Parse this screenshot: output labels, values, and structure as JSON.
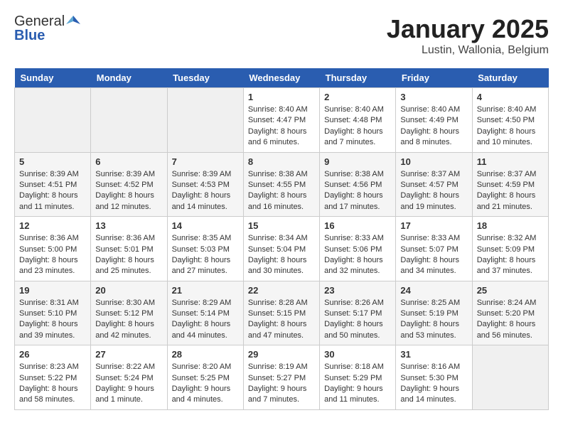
{
  "logo": {
    "general": "General",
    "blue": "Blue"
  },
  "title": "January 2025",
  "location": "Lustin, Wallonia, Belgium",
  "days_of_week": [
    "Sunday",
    "Monday",
    "Tuesday",
    "Wednesday",
    "Thursday",
    "Friday",
    "Saturday"
  ],
  "weeks": [
    [
      {
        "day": "",
        "content": ""
      },
      {
        "day": "",
        "content": ""
      },
      {
        "day": "",
        "content": ""
      },
      {
        "day": "1",
        "content": "Sunrise: 8:40 AM\nSunset: 4:47 PM\nDaylight: 8 hours\nand 6 minutes."
      },
      {
        "day": "2",
        "content": "Sunrise: 8:40 AM\nSunset: 4:48 PM\nDaylight: 8 hours\nand 7 minutes."
      },
      {
        "day": "3",
        "content": "Sunrise: 8:40 AM\nSunset: 4:49 PM\nDaylight: 8 hours\nand 8 minutes."
      },
      {
        "day": "4",
        "content": "Sunrise: 8:40 AM\nSunset: 4:50 PM\nDaylight: 8 hours\nand 10 minutes."
      }
    ],
    [
      {
        "day": "5",
        "content": "Sunrise: 8:39 AM\nSunset: 4:51 PM\nDaylight: 8 hours\nand 11 minutes."
      },
      {
        "day": "6",
        "content": "Sunrise: 8:39 AM\nSunset: 4:52 PM\nDaylight: 8 hours\nand 12 minutes."
      },
      {
        "day": "7",
        "content": "Sunrise: 8:39 AM\nSunset: 4:53 PM\nDaylight: 8 hours\nand 14 minutes."
      },
      {
        "day": "8",
        "content": "Sunrise: 8:38 AM\nSunset: 4:55 PM\nDaylight: 8 hours\nand 16 minutes."
      },
      {
        "day": "9",
        "content": "Sunrise: 8:38 AM\nSunset: 4:56 PM\nDaylight: 8 hours\nand 17 minutes."
      },
      {
        "day": "10",
        "content": "Sunrise: 8:37 AM\nSunset: 4:57 PM\nDaylight: 8 hours\nand 19 minutes."
      },
      {
        "day": "11",
        "content": "Sunrise: 8:37 AM\nSunset: 4:59 PM\nDaylight: 8 hours\nand 21 minutes."
      }
    ],
    [
      {
        "day": "12",
        "content": "Sunrise: 8:36 AM\nSunset: 5:00 PM\nDaylight: 8 hours\nand 23 minutes."
      },
      {
        "day": "13",
        "content": "Sunrise: 8:36 AM\nSunset: 5:01 PM\nDaylight: 8 hours\nand 25 minutes."
      },
      {
        "day": "14",
        "content": "Sunrise: 8:35 AM\nSunset: 5:03 PM\nDaylight: 8 hours\nand 27 minutes."
      },
      {
        "day": "15",
        "content": "Sunrise: 8:34 AM\nSunset: 5:04 PM\nDaylight: 8 hours\nand 30 minutes."
      },
      {
        "day": "16",
        "content": "Sunrise: 8:33 AM\nSunset: 5:06 PM\nDaylight: 8 hours\nand 32 minutes."
      },
      {
        "day": "17",
        "content": "Sunrise: 8:33 AM\nSunset: 5:07 PM\nDaylight: 8 hours\nand 34 minutes."
      },
      {
        "day": "18",
        "content": "Sunrise: 8:32 AM\nSunset: 5:09 PM\nDaylight: 8 hours\nand 37 minutes."
      }
    ],
    [
      {
        "day": "19",
        "content": "Sunrise: 8:31 AM\nSunset: 5:10 PM\nDaylight: 8 hours\nand 39 minutes."
      },
      {
        "day": "20",
        "content": "Sunrise: 8:30 AM\nSunset: 5:12 PM\nDaylight: 8 hours\nand 42 minutes."
      },
      {
        "day": "21",
        "content": "Sunrise: 8:29 AM\nSunset: 5:14 PM\nDaylight: 8 hours\nand 44 minutes."
      },
      {
        "day": "22",
        "content": "Sunrise: 8:28 AM\nSunset: 5:15 PM\nDaylight: 8 hours\nand 47 minutes."
      },
      {
        "day": "23",
        "content": "Sunrise: 8:26 AM\nSunset: 5:17 PM\nDaylight: 8 hours\nand 50 minutes."
      },
      {
        "day": "24",
        "content": "Sunrise: 8:25 AM\nSunset: 5:19 PM\nDaylight: 8 hours\nand 53 minutes."
      },
      {
        "day": "25",
        "content": "Sunrise: 8:24 AM\nSunset: 5:20 PM\nDaylight: 8 hours\nand 56 minutes."
      }
    ],
    [
      {
        "day": "26",
        "content": "Sunrise: 8:23 AM\nSunset: 5:22 PM\nDaylight: 8 hours\nand 58 minutes."
      },
      {
        "day": "27",
        "content": "Sunrise: 8:22 AM\nSunset: 5:24 PM\nDaylight: 9 hours\nand 1 minute."
      },
      {
        "day": "28",
        "content": "Sunrise: 8:20 AM\nSunset: 5:25 PM\nDaylight: 9 hours\nand 4 minutes."
      },
      {
        "day": "29",
        "content": "Sunrise: 8:19 AM\nSunset: 5:27 PM\nDaylight: 9 hours\nand 7 minutes."
      },
      {
        "day": "30",
        "content": "Sunrise: 8:18 AM\nSunset: 5:29 PM\nDaylight: 9 hours\nand 11 minutes."
      },
      {
        "day": "31",
        "content": "Sunrise: 8:16 AM\nSunset: 5:30 PM\nDaylight: 9 hours\nand 14 minutes."
      },
      {
        "day": "",
        "content": ""
      }
    ]
  ]
}
